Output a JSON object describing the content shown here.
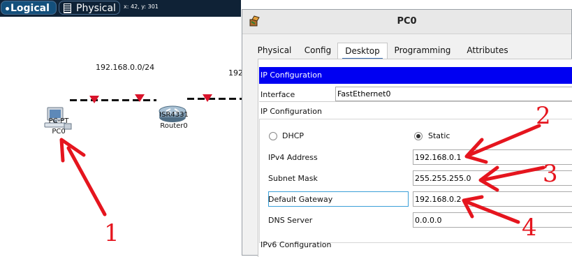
{
  "toolbar": {
    "logical_label": "Logical",
    "physical_label": "Physical",
    "coordinates": "x: 42, y: 301"
  },
  "topology": {
    "network_label": "192.168.0.0/24",
    "network_label_right": "192",
    "pc": {
      "type": "PC-PT",
      "name": "PC0",
      "icon": "pc-icon"
    },
    "router": {
      "type": "ISR4331",
      "name": "Router0",
      "icon": "router-icon"
    },
    "link_color": "#111111",
    "status_color": "#d9142b"
  },
  "annotations": {
    "one": "1",
    "two": "2",
    "three": "3",
    "four": "4",
    "color": "#e5151e"
  },
  "dialog": {
    "title": "PC0",
    "icon": "packet-tracer-icon",
    "tabs": [
      "Physical",
      "Config",
      "Desktop",
      "Programming",
      "Attributes"
    ],
    "active_tab": "Desktop",
    "ip_configuration_bar": "IP Configuration",
    "interface_label": "Interface",
    "interface_value": "FastEthernet0",
    "ip_configuration_group": "IP Configuration",
    "dhcp_label": "DHCP",
    "static_label": "Static",
    "mode_selected": "Static",
    "ipv4_label": "IPv4 Address",
    "ipv4_value": "192.168.0.1",
    "subnet_label": "Subnet Mask",
    "subnet_value": "255.255.255.0",
    "gateway_label": "Default Gateway",
    "gateway_value": "192.168.0.2",
    "dns_label": "DNS Server",
    "dns_value": "0.0.0.0",
    "ipv6_label": "IPv6 Configuration",
    "accent_color": "#0000f2"
  }
}
